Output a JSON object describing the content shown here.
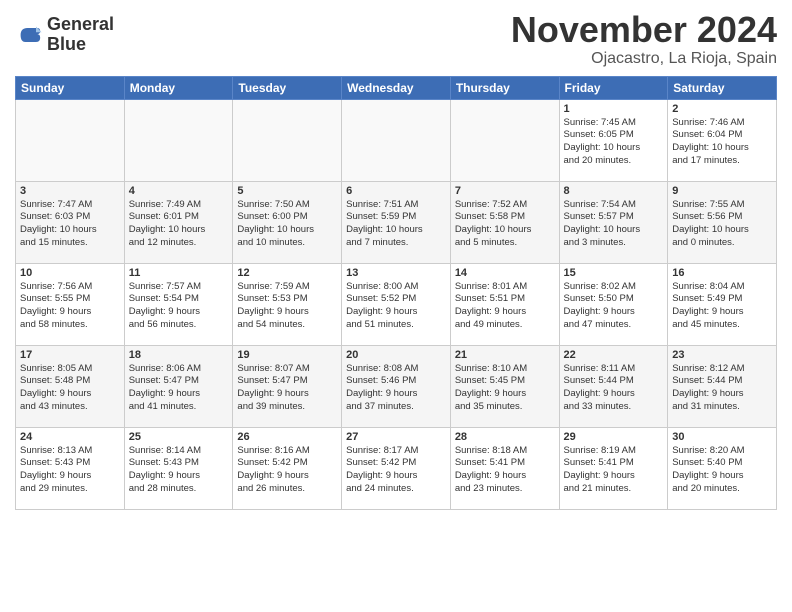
{
  "header": {
    "logo_line1": "General",
    "logo_line2": "Blue",
    "month_title": "November 2024",
    "subtitle": "Ojacastro, La Rioja, Spain"
  },
  "weekdays": [
    "Sunday",
    "Monday",
    "Tuesday",
    "Wednesday",
    "Thursday",
    "Friday",
    "Saturday"
  ],
  "weeks": [
    [
      {
        "day": "",
        "info": ""
      },
      {
        "day": "",
        "info": ""
      },
      {
        "day": "",
        "info": ""
      },
      {
        "day": "",
        "info": ""
      },
      {
        "day": "",
        "info": ""
      },
      {
        "day": "1",
        "info": "Sunrise: 7:45 AM\nSunset: 6:05 PM\nDaylight: 10 hours\nand 20 minutes."
      },
      {
        "day": "2",
        "info": "Sunrise: 7:46 AM\nSunset: 6:04 PM\nDaylight: 10 hours\nand 17 minutes."
      }
    ],
    [
      {
        "day": "3",
        "info": "Sunrise: 7:47 AM\nSunset: 6:03 PM\nDaylight: 10 hours\nand 15 minutes."
      },
      {
        "day": "4",
        "info": "Sunrise: 7:49 AM\nSunset: 6:01 PM\nDaylight: 10 hours\nand 12 minutes."
      },
      {
        "day": "5",
        "info": "Sunrise: 7:50 AM\nSunset: 6:00 PM\nDaylight: 10 hours\nand 10 minutes."
      },
      {
        "day": "6",
        "info": "Sunrise: 7:51 AM\nSunset: 5:59 PM\nDaylight: 10 hours\nand 7 minutes."
      },
      {
        "day": "7",
        "info": "Sunrise: 7:52 AM\nSunset: 5:58 PM\nDaylight: 10 hours\nand 5 minutes."
      },
      {
        "day": "8",
        "info": "Sunrise: 7:54 AM\nSunset: 5:57 PM\nDaylight: 10 hours\nand 3 minutes."
      },
      {
        "day": "9",
        "info": "Sunrise: 7:55 AM\nSunset: 5:56 PM\nDaylight: 10 hours\nand 0 minutes."
      }
    ],
    [
      {
        "day": "10",
        "info": "Sunrise: 7:56 AM\nSunset: 5:55 PM\nDaylight: 9 hours\nand 58 minutes."
      },
      {
        "day": "11",
        "info": "Sunrise: 7:57 AM\nSunset: 5:54 PM\nDaylight: 9 hours\nand 56 minutes."
      },
      {
        "day": "12",
        "info": "Sunrise: 7:59 AM\nSunset: 5:53 PM\nDaylight: 9 hours\nand 54 minutes."
      },
      {
        "day": "13",
        "info": "Sunrise: 8:00 AM\nSunset: 5:52 PM\nDaylight: 9 hours\nand 51 minutes."
      },
      {
        "day": "14",
        "info": "Sunrise: 8:01 AM\nSunset: 5:51 PM\nDaylight: 9 hours\nand 49 minutes."
      },
      {
        "day": "15",
        "info": "Sunrise: 8:02 AM\nSunset: 5:50 PM\nDaylight: 9 hours\nand 47 minutes."
      },
      {
        "day": "16",
        "info": "Sunrise: 8:04 AM\nSunset: 5:49 PM\nDaylight: 9 hours\nand 45 minutes."
      }
    ],
    [
      {
        "day": "17",
        "info": "Sunrise: 8:05 AM\nSunset: 5:48 PM\nDaylight: 9 hours\nand 43 minutes."
      },
      {
        "day": "18",
        "info": "Sunrise: 8:06 AM\nSunset: 5:47 PM\nDaylight: 9 hours\nand 41 minutes."
      },
      {
        "day": "19",
        "info": "Sunrise: 8:07 AM\nSunset: 5:47 PM\nDaylight: 9 hours\nand 39 minutes."
      },
      {
        "day": "20",
        "info": "Sunrise: 8:08 AM\nSunset: 5:46 PM\nDaylight: 9 hours\nand 37 minutes."
      },
      {
        "day": "21",
        "info": "Sunrise: 8:10 AM\nSunset: 5:45 PM\nDaylight: 9 hours\nand 35 minutes."
      },
      {
        "day": "22",
        "info": "Sunrise: 8:11 AM\nSunset: 5:44 PM\nDaylight: 9 hours\nand 33 minutes."
      },
      {
        "day": "23",
        "info": "Sunrise: 8:12 AM\nSunset: 5:44 PM\nDaylight: 9 hours\nand 31 minutes."
      }
    ],
    [
      {
        "day": "24",
        "info": "Sunrise: 8:13 AM\nSunset: 5:43 PM\nDaylight: 9 hours\nand 29 minutes."
      },
      {
        "day": "25",
        "info": "Sunrise: 8:14 AM\nSunset: 5:43 PM\nDaylight: 9 hours\nand 28 minutes."
      },
      {
        "day": "26",
        "info": "Sunrise: 8:16 AM\nSunset: 5:42 PM\nDaylight: 9 hours\nand 26 minutes."
      },
      {
        "day": "27",
        "info": "Sunrise: 8:17 AM\nSunset: 5:42 PM\nDaylight: 9 hours\nand 24 minutes."
      },
      {
        "day": "28",
        "info": "Sunrise: 8:18 AM\nSunset: 5:41 PM\nDaylight: 9 hours\nand 23 minutes."
      },
      {
        "day": "29",
        "info": "Sunrise: 8:19 AM\nSunset: 5:41 PM\nDaylight: 9 hours\nand 21 minutes."
      },
      {
        "day": "30",
        "info": "Sunrise: 8:20 AM\nSunset: 5:40 PM\nDaylight: 9 hours\nand 20 minutes."
      }
    ]
  ]
}
